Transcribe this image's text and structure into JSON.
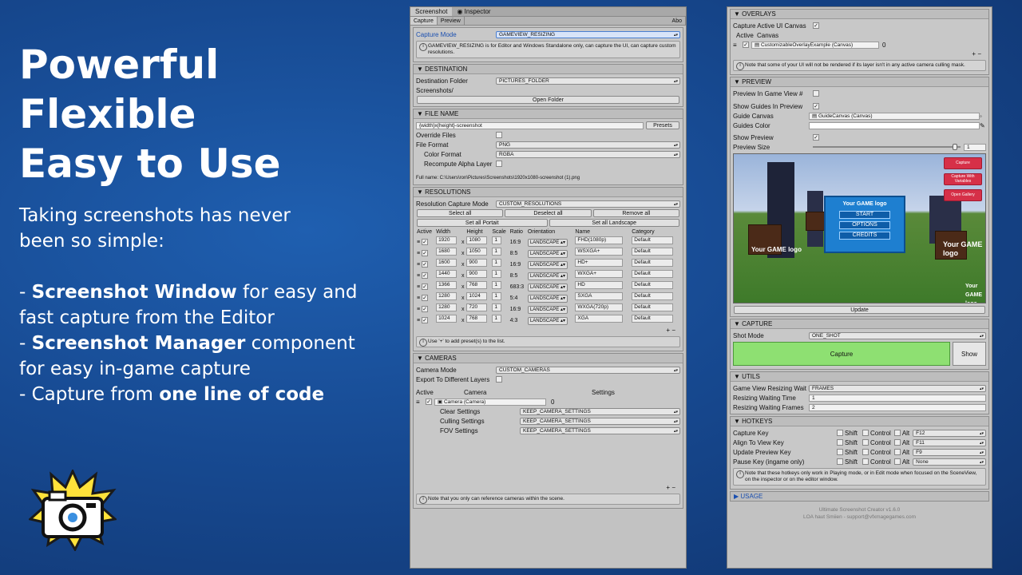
{
  "promo": {
    "headline": [
      "Powerful",
      "Flexible",
      "Easy to Use"
    ],
    "tagline_1": "Taking screenshots has never",
    "tagline_2": "been so simple:",
    "b1_pre": "- ",
    "b1_bold": "Screenshot Window",
    "b1_post": " for easy and",
    "b1_line2": "fast capture from the Editor",
    "b2_bold": "Screenshot Manager",
    "b2_post": " component",
    "b2_line2": "for easy in-game capture",
    "b3_pre": "- Capture from ",
    "b3_bold": "one line of code"
  },
  "left": {
    "tabs": [
      "Screenshot",
      "Inspector"
    ],
    "subtabs": [
      "Capture",
      "Preview",
      "Abo"
    ],
    "capture_mode_label": "Capture Mode",
    "capture_mode_value": "GAMEVIEW_RESIZING",
    "capture_note": "GAMEVIEW_RESIZING is for Editor and Windows Standalone only, can capture the UI, can capture custom resolutions.",
    "destination": {
      "title": "DESTINATION",
      "folder_label": "Destination Folder",
      "folder_value": "PICTURES_FOLDER",
      "path": "Screenshots/",
      "open_button": "Open Folder"
    },
    "filename": {
      "title": "FILE NAME",
      "pattern": "{width}x{height}-screenshot",
      "presets": "Presets",
      "override_label": "Override Files",
      "format_label": "File Format",
      "format_value": "PNG",
      "color_label": "Color Format",
      "color_value": "RGBA",
      "alpha_label": "Recompute Alpha Layer",
      "fullname": "Full name: C:\\Users\\ron\\Pictures\\Screenshots\\1920x1080-screenshot (1).png"
    },
    "resolutions": {
      "title": "RESOLUTIONS",
      "mode_label": "Resolution Capture Mode",
      "mode_value": "CUSTOM_RESOLUTIONS",
      "select_all": "Select all",
      "deselect_all": "Deselect all",
      "remove_all": "Remove all",
      "set_portrait": "Set all Portait",
      "set_landscape": "Set all Landscape",
      "headers": [
        "Active",
        "Width",
        "Height",
        "Scale",
        "Ratio",
        "Orientation",
        "Name",
        "Category"
      ],
      "rows": [
        {
          "w": "1920",
          "h": "1080",
          "s": "1",
          "r": "16:9",
          "o": "LANDSCAPE",
          "n": "FHD(1080p)",
          "c": "Default"
        },
        {
          "w": "1680",
          "h": "1050",
          "s": "1",
          "r": "8:5",
          "o": "LANDSCAPE",
          "n": "WSXGA+",
          "c": "Default"
        },
        {
          "w": "1600",
          "h": "900",
          "s": "1",
          "r": "16:9",
          "o": "LANDSCAPE",
          "n": "HD+",
          "c": "Default"
        },
        {
          "w": "1440",
          "h": "900",
          "s": "1",
          "r": "8:5",
          "o": "LANDSCAPE",
          "n": "WXGA+",
          "c": "Default"
        },
        {
          "w": "1366",
          "h": "768",
          "s": "1",
          "r": "683:3",
          "o": "LANDSCAPE",
          "n": "HD",
          "c": "Default"
        },
        {
          "w": "1280",
          "h": "1024",
          "s": "1",
          "r": "5:4",
          "o": "LANDSCAPE",
          "n": "SXGA",
          "c": "Default"
        },
        {
          "w": "1280",
          "h": "720",
          "s": "1",
          "r": "16:9",
          "o": "LANDSCAPE",
          "n": "WXGA(720p)",
          "c": "Default"
        },
        {
          "w": "1024",
          "h": "768",
          "s": "1",
          "r": "4:3",
          "o": "LANDSCAPE",
          "n": "XGA",
          "c": "Default"
        }
      ],
      "x_sep": "x",
      "plus_minus": "+ −",
      "note": "Use '+' to add preset(s) to the list."
    },
    "cameras": {
      "title": "CAMERAS",
      "mode_label": "Camera Mode",
      "mode_value": "CUSTOM_CAMERAS",
      "export_label": "Export To Different Layers",
      "h_active": "Active",
      "h_camera": "Camera",
      "h_settings": "Settings",
      "camera_value": "Camera (Camera)",
      "camera_index": "0",
      "clear_label": "Clear Settings",
      "culling_label": "Culling Settings",
      "fov_label": "FOV Settings",
      "keep": "KEEP_CAMERA_SETTINGS",
      "plus_minus": "+ −",
      "note": "Note that you only can reference cameras within the scene."
    }
  },
  "right": {
    "overlays": {
      "title": "OVERLAYS",
      "capture_label": "Capture Active UI Canvas",
      "h_active": "Active",
      "h_canvas": "Canvas",
      "canvas_value": "CustomizableOverlayExample (Canvas)",
      "canvas_index": "0",
      "plus_minus": "+ −",
      "note": "Note that some of your UI will not be rendered if its layer isn't in any active camera culling mask."
    },
    "preview": {
      "title": "PREVIEW",
      "in_game_label": "Preview In Game View #",
      "guides_label": "Show Guides In Preview",
      "canvas_label": "Guide Canvas",
      "canvas_value": "GuideCanvas (Canvas)",
      "color_label": "Guides Color",
      "show_label": "Show Preview",
      "size_label": "Preview Size",
      "size_value": "1",
      "size_level": 0.96,
      "game_logo_small": "Your GAME logo",
      "menu_items": [
        "START",
        "OPTIONS",
        "CREDITS"
      ],
      "pink_buttons": [
        "Capture",
        "Capture With Variables",
        "Open Gallery"
      ],
      "update": "Update"
    },
    "capture": {
      "title": "CAPTURE",
      "shot_label": "Shot Mode",
      "shot_value": "ONE_SHOT",
      "capture_button": "Capture",
      "show_button": "Show"
    },
    "utils": {
      "title": "UTILS",
      "mode_label": "Game View Resizing Wait Mode",
      "mode_value": "FRAMES",
      "time_label": "Resizing Waiting Time",
      "time_value": "1",
      "frames_label": "Resizing Waiting Frames",
      "frames_value": "2"
    },
    "hotkeys": {
      "title": "HOTKEYS",
      "shift": "Shift",
      "control": "Control",
      "alt": "Alt",
      "rows": [
        {
          "label": "Capture Key",
          "key": "F12"
        },
        {
          "label": "Align To View Key",
          "key": "F11"
        },
        {
          "label": "Update Preview Key",
          "key": "F9"
        },
        {
          "label": "Pause Key (ingame only)",
          "key": "None"
        }
      ],
      "note": "Note that these hotkeys only work in Playing mode, or in Edit mode when focused on the SceneView, on the inspector or on the editor window."
    },
    "usage": "USAGE",
    "footer_1": "Ultimate Screenshot Creator v1.6.0",
    "footer_2": "LOA haut Smiien - support@vfxmagegames.com"
  },
  "colors": {
    "capture_green": "#8ee072",
    "pink": "#d63048",
    "menu_blue": "#1e7fd0"
  }
}
